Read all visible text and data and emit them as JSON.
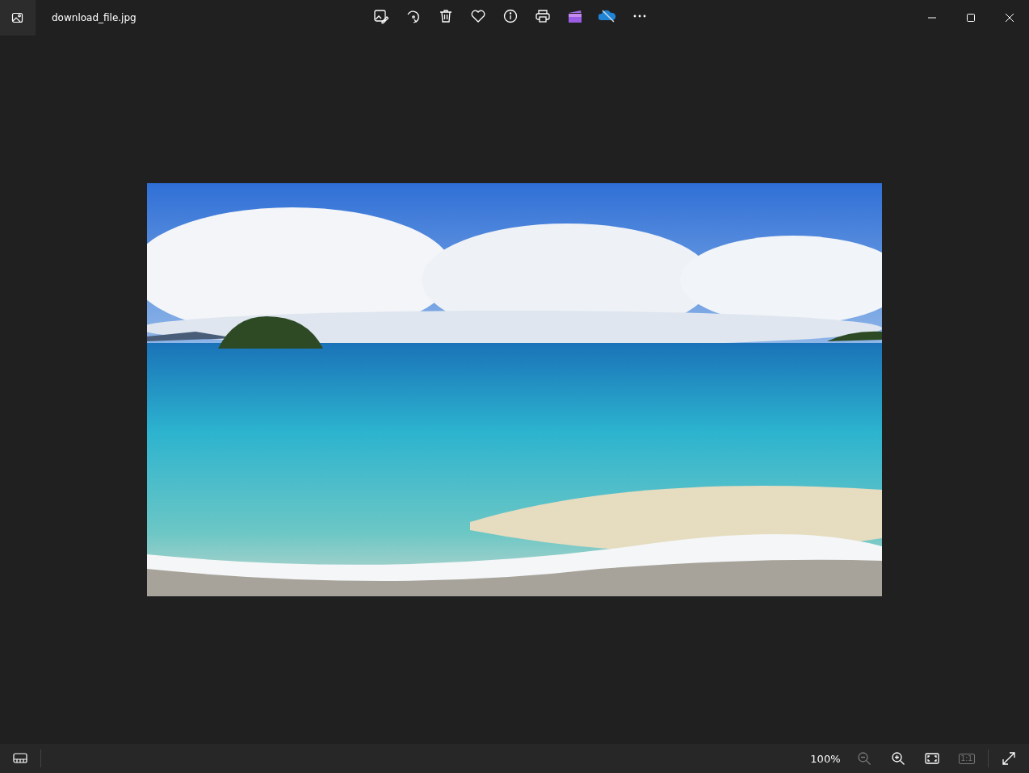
{
  "window": {
    "title": "download_file.jpg"
  },
  "status_bar": {
    "zoom": "100%",
    "zoom_out_disabled": true,
    "actual_size": {
      "label": "1:1",
      "disabled": true
    }
  }
}
